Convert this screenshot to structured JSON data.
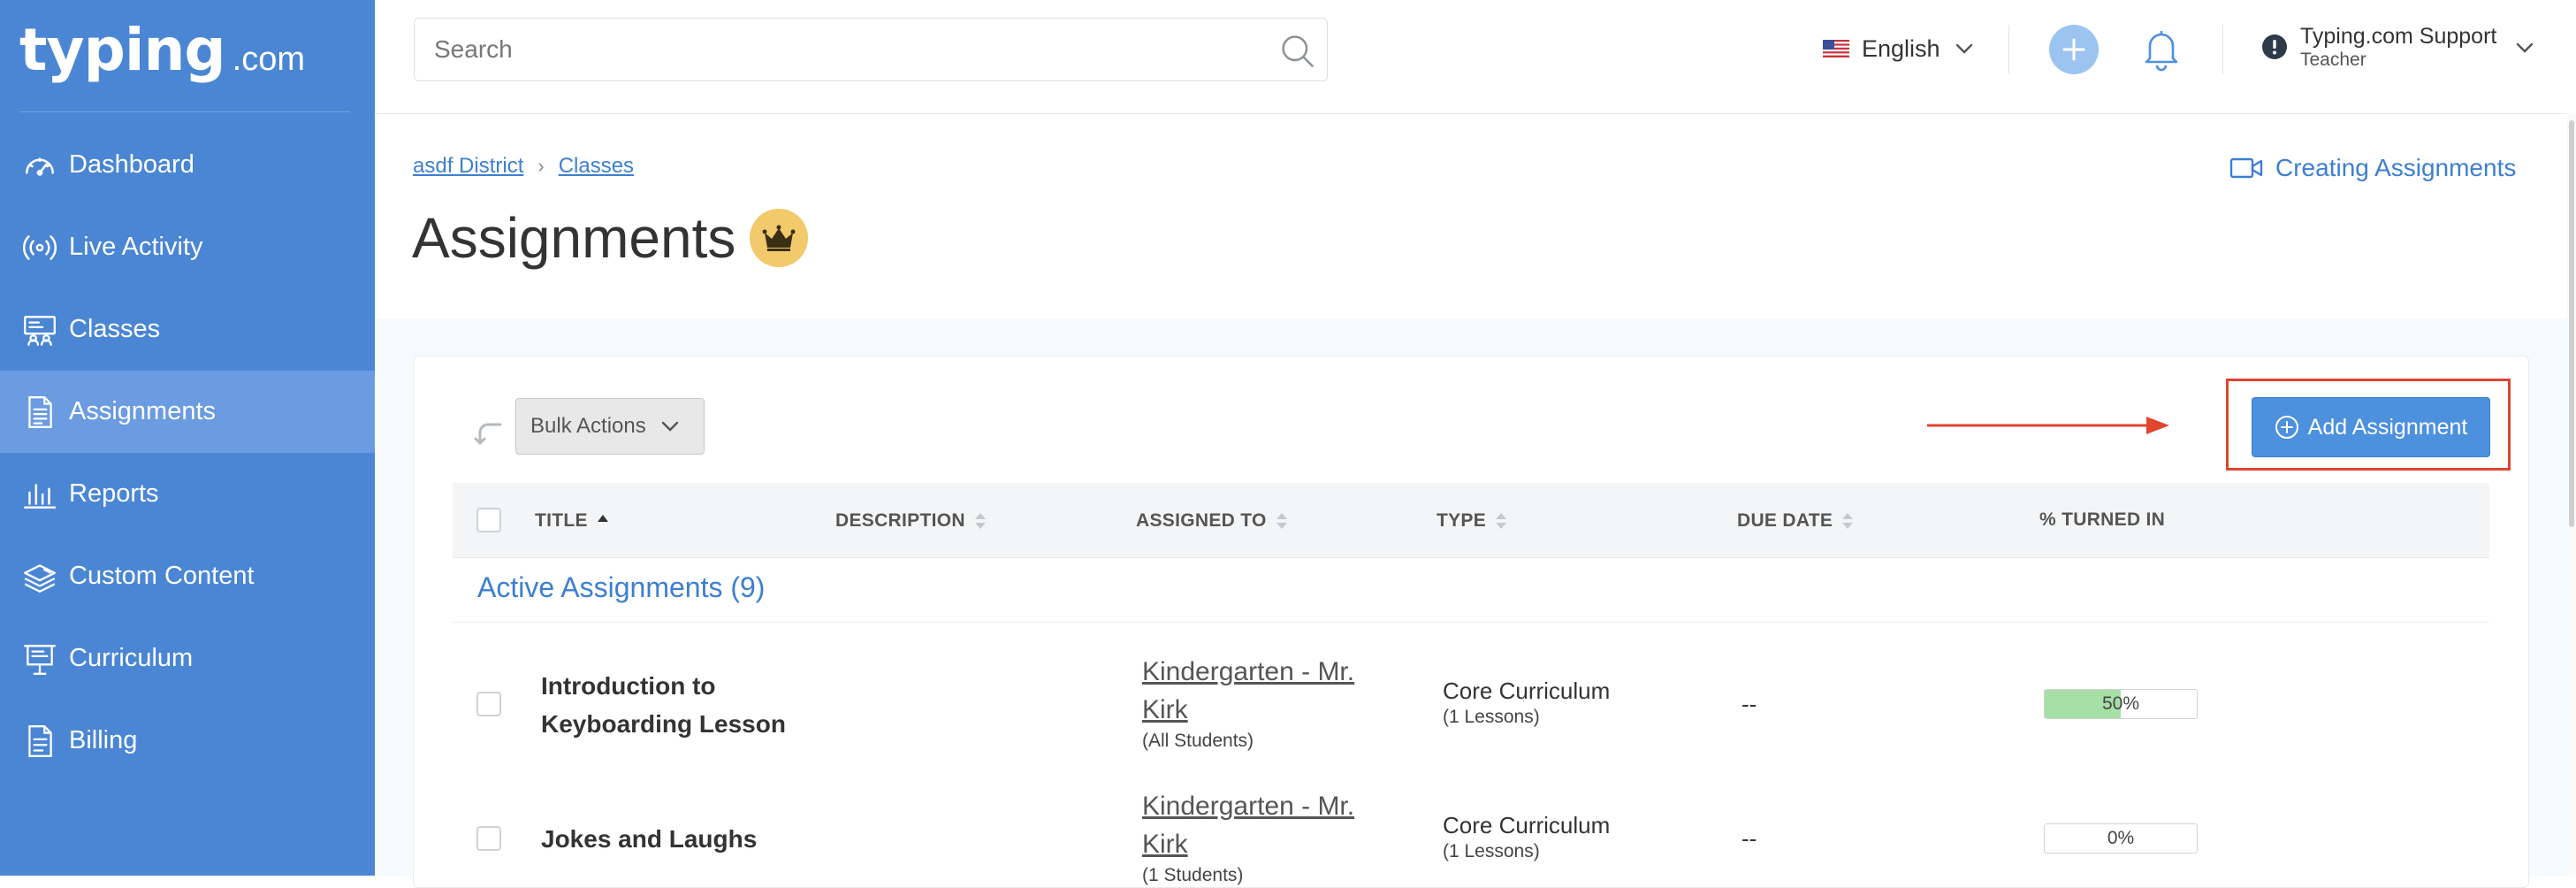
{
  "logo": {
    "main": "typing",
    "domain": ".com"
  },
  "sidebar": {
    "items": [
      {
        "label": "Dashboard",
        "icon": "gauge-icon"
      },
      {
        "label": "Live Activity",
        "icon": "broadcast-icon"
      },
      {
        "label": "Classes",
        "icon": "classroom-icon"
      },
      {
        "label": "Assignments",
        "icon": "document-list-icon",
        "active": true
      },
      {
        "label": "Reports",
        "icon": "bar-chart-icon"
      },
      {
        "label": "Custom Content",
        "icon": "layers-edit-icon"
      },
      {
        "label": "Curriculum",
        "icon": "presentation-icon"
      },
      {
        "label": "Billing",
        "icon": "receipt-icon"
      }
    ]
  },
  "topbar": {
    "search_placeholder": "Search",
    "language": "English",
    "user_name": "Typing.com Support",
    "user_role": "Teacher"
  },
  "breadcrumb": {
    "items": [
      "asdf District",
      "Classes"
    ],
    "separator": "›"
  },
  "help_link": "Creating Assignments",
  "page_title": "Assignments",
  "toolbar": {
    "bulk_actions": "Bulk Actions",
    "add_assignment": "Add Assignment"
  },
  "table": {
    "columns": [
      "TITLE",
      "DESCRIPTION",
      "ASSIGNED TO",
      "TYPE",
      "DUE DATE",
      "% TURNED IN"
    ],
    "section_title": "Active Assignments (9)",
    "rows": [
      {
        "title": "Introduction to Keyboarding Lesson",
        "assigned_to": "Kindergarten - Mr. Kirk",
        "assigned_sub": "(All Students)",
        "type": "Core Curriculum",
        "type_sub": "(1 Lessons)",
        "due": "--",
        "turned_in_label": "50%",
        "turned_in": 0.5
      },
      {
        "title": "Jokes and Laughs",
        "assigned_to": "Kindergarten - Mr. Kirk",
        "assigned_sub": "(1 Students)",
        "type": "Core Curriculum",
        "type_sub": "(1 Lessons)",
        "due": "--",
        "turned_in_label": "0%",
        "turned_in": 0
      }
    ]
  },
  "colors": {
    "sidebar": "#4a86d4",
    "accent": "#3d7fd1",
    "highlight": "#e0452e",
    "progress_fill": "#a6e0a6"
  }
}
